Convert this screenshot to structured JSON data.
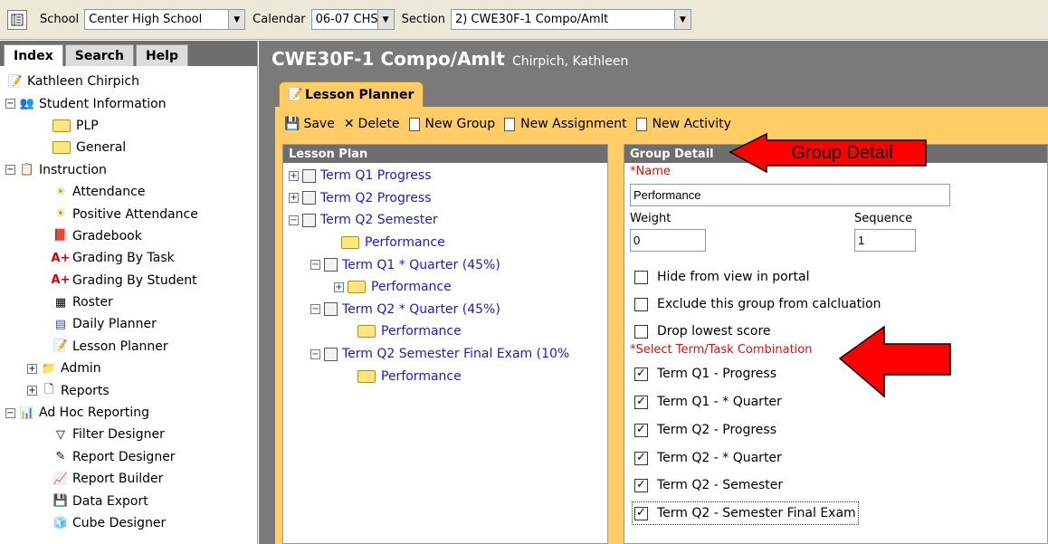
{
  "topbar": {
    "school_label": "School",
    "school_value": "Center High School",
    "calendar_label": "Calendar",
    "calendar_value": "06-07 CHS",
    "section_label": "Section",
    "section_value": "2) CWE30F-1 Compo/Amlt"
  },
  "nav": {
    "tabs": [
      "Index",
      "Search",
      "Help"
    ],
    "user": "Kathleen Chirpich",
    "items": {
      "student_information": "Student Information",
      "plp": "PLP",
      "general": "General",
      "instruction": "Instruction",
      "attendance": "Attendance",
      "positive_attendance": "Positive Attendance",
      "gradebook": "Gradebook",
      "grading_by_task": "Grading By Task",
      "grading_by_student": "Grading By Student",
      "roster": "Roster",
      "daily_planner": "Daily Planner",
      "lesson_planner": "Lesson Planner",
      "admin": "Admin",
      "reports": "Reports",
      "ad_hoc_reporting": "Ad Hoc Reporting",
      "filter_designer": "Filter Designer",
      "report_designer": "Report Designer",
      "report_builder": "Report Builder",
      "data_export": "Data Export",
      "cube_designer": "Cube Designer"
    }
  },
  "main": {
    "title": "CWE30F-1 Compo/Amlt",
    "teacher": "Chirpich, Kathleen",
    "tab": "Lesson Planner",
    "toolbar": {
      "save": "Save",
      "delete": "Delete",
      "new_group": "New Group",
      "new_assignment": "New Assignment",
      "new_activity": "New Activity"
    }
  },
  "lesson_plan": {
    "header": "Lesson Plan",
    "rows": [
      "Term Q1 Progress",
      "Term Q2 Progress",
      "Term Q2 Semester",
      "Performance",
      "Term Q1 * Quarter (45%)",
      "Performance",
      "Term Q2 * Quarter (45%)",
      "Performance",
      "Term Q2 Semester Final Exam (10%",
      "Performance"
    ]
  },
  "group_detail": {
    "header": "Group Detail",
    "name_label": "*Name",
    "name_value": "Performance",
    "weight_label": "Weight",
    "weight_value": "0",
    "sequence_label": "Sequence",
    "sequence_value": "1",
    "options": [
      "Hide from view in portal",
      "Exclude this group from calcluation",
      "Drop lowest score"
    ],
    "term_task_label": "*Select Term/Task Combination",
    "combinations": [
      "Term Q1 - Progress",
      "Term Q1 - * Quarter",
      "Term Q2 - Progress",
      "Term Q2 - * Quarter",
      "Term Q2 - Semester",
      "Term Q2 - Semester Final Exam"
    ]
  },
  "annotation": {
    "callout": "Group Detail"
  },
  "colors": {
    "panel_orange": "#ffcc66",
    "header_gray": "#6e6e6e",
    "link_blue": "#1a1ad0",
    "required_red": "#e01010",
    "arrow_red": "#ff0000"
  }
}
